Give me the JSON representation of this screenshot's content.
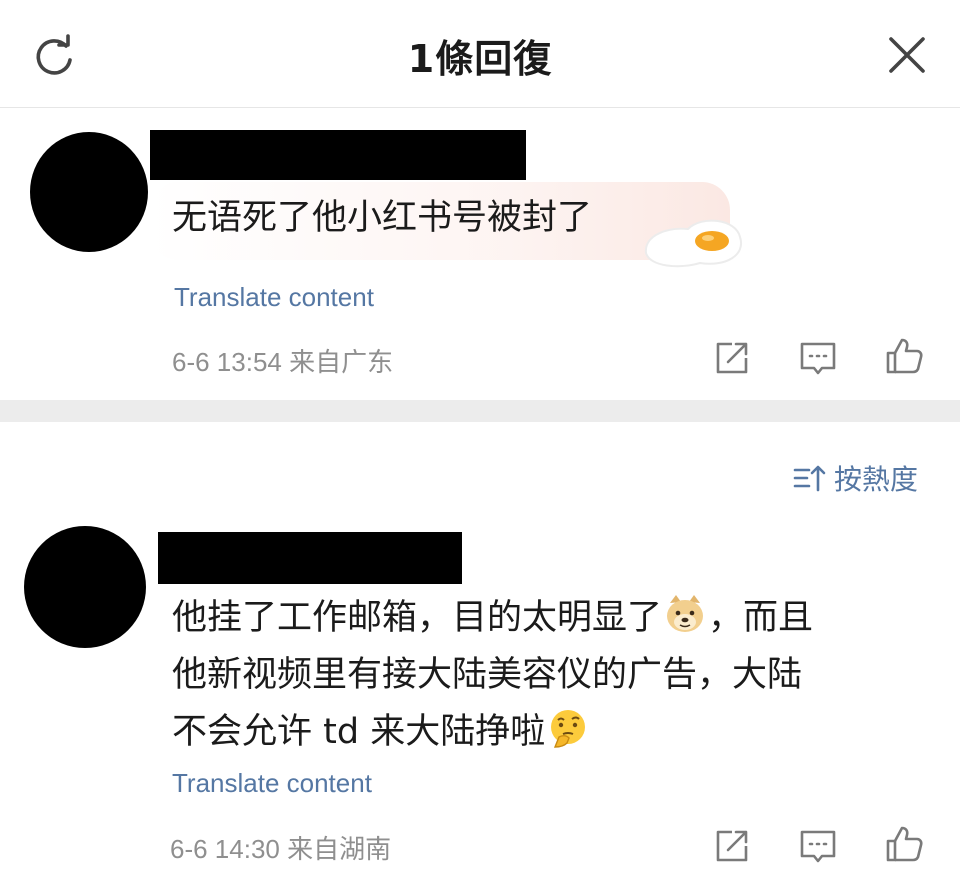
{
  "header": {
    "title": "1條回復",
    "refresh_icon": "refresh-icon",
    "close_icon": "close-icon"
  },
  "comments": [
    {
      "text": "无语死了他小红书号被封了",
      "sticker_icon": "fried-egg-sticker-icon",
      "translate": "Translate content",
      "meta": "6-6 13:54 来自广东"
    },
    {
      "line1_a": "他挂了工作邮箱，目的太明显了",
      "line1_b": "，而且",
      "line2": "他新视频里有接大陆美容仪的广告，大陆",
      "line3_a": "不会允许 td 来大陆挣啦",
      "emoji1": "doge-emoji",
      "emoji2": "thinking-face-emoji",
      "translate": "Translate content",
      "meta": "6-6 14:30 来自湖南"
    }
  ],
  "sort": {
    "label": "按熱度",
    "icon": "sort-icon"
  },
  "actions": {
    "forward_icon": "forward-icon",
    "comment_icon": "comment-icon",
    "like_icon": "like-icon"
  },
  "colors": {
    "link": "#5577a3",
    "meta": "#8f8f8f",
    "divider": "#ececec"
  }
}
